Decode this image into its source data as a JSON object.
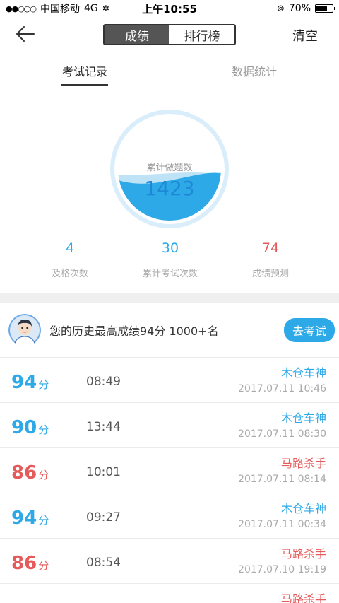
{
  "status": {
    "carrier": "中国移动",
    "network": "4G",
    "time": "上午10:55",
    "battery": "70%"
  },
  "nav": {
    "seg_active": "成绩",
    "seg_inactive": "排行榜",
    "clear": "清空"
  },
  "tabs": [
    {
      "label": "考试记录"
    },
    {
      "label": "数据统计"
    }
  ],
  "gauge": {
    "label": "累计做题数",
    "value": "1423",
    "fill_fraction": 0.45
  },
  "counts": [
    {
      "value": "4",
      "label": "及格次数"
    },
    {
      "value": "30",
      "label": "累计考试次数"
    },
    {
      "value": "74",
      "label": "成绩预测"
    }
  ],
  "best": {
    "text": "您的历史最高成绩94分  1000+名",
    "button": "去考试"
  },
  "score_unit": "分",
  "records": [
    {
      "score": "94",
      "duration": "08:49",
      "title": "木仓车神",
      "date": "2017.07.11 10:46"
    },
    {
      "score": "90",
      "duration": "13:44",
      "title": "木仓车神",
      "date": "2017.07.11 08:30"
    },
    {
      "score": "86",
      "duration": "10:01",
      "title": "马路杀手",
      "date": "2017.07.11 08:14"
    },
    {
      "score": "94",
      "duration": "09:27",
      "title": "木仓车神",
      "date": "2017.07.11 00:34"
    },
    {
      "score": "86",
      "duration": "08:54",
      "title": "马路杀手",
      "date": "2017.07.10 19:19"
    },
    {
      "score": "",
      "duration": "",
      "title": "马路杀手",
      "date": ""
    }
  ],
  "colors": {
    "accent": "#2ea9e8",
    "fail": "#e55a5a"
  }
}
